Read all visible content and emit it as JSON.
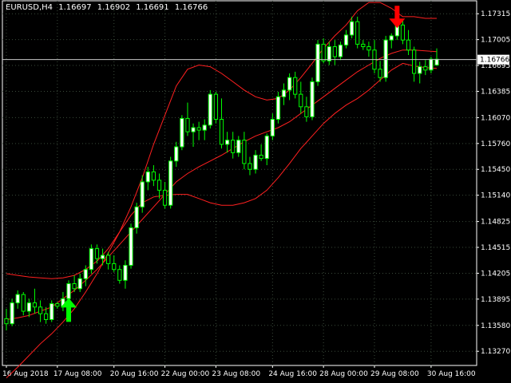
{
  "header": {
    "symbol": "EURUSD,H4",
    "open": "1.16697",
    "high": "1.16902",
    "low": "1.16691",
    "close": "1.16766"
  },
  "colors": {
    "background": "#000000",
    "grid": "#3a4a3a",
    "bull_candle": "#ffffff",
    "bear_candle": "#000000",
    "candle_outline": "#00ff00",
    "bands": "#ff2020",
    "buy_arrow": "#00ff00",
    "sell_arrow": "#ff0000",
    "price_line": "#c8c8c8"
  },
  "chart_data": {
    "type": "candlestick",
    "symbol": "EURUSD",
    "timeframe": "H4",
    "ylim": [
      1.131,
      1.1747
    ],
    "y_ticks": [
      "1.17315",
      "1.17005",
      "1.16695",
      "1.16385",
      "1.16070",
      "1.15760",
      "1.15450",
      "1.15140",
      "1.14825",
      "1.14515",
      "1.14205",
      "1.13895",
      "1.13580",
      "1.13270"
    ],
    "x_ticks": [
      "16 Aug 2018",
      "17 Aug 08:00",
      "20 Aug 16:00",
      "22 Aug 00:00",
      "23 Aug 08:00",
      "24 Aug 16:00",
      "28 Aug 00:00",
      "29 Aug 08:00",
      "30 Aug 16:00"
    ],
    "current_price": 1.16766,
    "current_price_label": "1.16766",
    "candles": [
      [
        1.1366,
        1.1378,
        1.1352,
        1.136
      ],
      [
        1.136,
        1.139,
        1.1357,
        1.1385
      ],
      [
        1.1385,
        1.14,
        1.1378,
        1.1395
      ],
      [
        1.1395,
        1.1398,
        1.137,
        1.1375
      ],
      [
        1.1375,
        1.139,
        1.1368,
        1.1385
      ],
      [
        1.1385,
        1.1402,
        1.1372,
        1.138
      ],
      [
        1.138,
        1.1388,
        1.1362,
        1.1372
      ],
      [
        1.1372,
        1.138,
        1.136,
        1.1365
      ],
      [
        1.1365,
        1.1388,
        1.1362,
        1.1384
      ],
      [
        1.1384,
        1.1386,
        1.1378,
        1.1381
      ],
      [
        1.1381,
        1.1398,
        1.1375,
        1.139
      ],
      [
        1.139,
        1.1412,
        1.1386,
        1.1408
      ],
      [
        1.1408,
        1.1418,
        1.1398,
        1.1402
      ],
      [
        1.1402,
        1.142,
        1.1398,
        1.1414
      ],
      [
        1.1414,
        1.143,
        1.1405,
        1.1425
      ],
      [
        1.1425,
        1.1455,
        1.142,
        1.145
      ],
      [
        1.145,
        1.1455,
        1.1432,
        1.1438
      ],
      [
        1.1438,
        1.145,
        1.143,
        1.1442
      ],
      [
        1.1442,
        1.1446,
        1.1425,
        1.1432
      ],
      [
        1.1432,
        1.1442,
        1.1422,
        1.1425
      ],
      [
        1.1425,
        1.143,
        1.1408,
        1.1412
      ],
      [
        1.1412,
        1.1436,
        1.1402,
        1.143
      ],
      [
        1.143,
        1.148,
        1.1426,
        1.1475
      ],
      [
        1.1475,
        1.1505,
        1.1468,
        1.15
      ],
      [
        1.15,
        1.1538,
        1.1493,
        1.153
      ],
      [
        1.153,
        1.1548,
        1.152,
        1.1542
      ],
      [
        1.1542,
        1.155,
        1.1525,
        1.1532
      ],
      [
        1.1532,
        1.154,
        1.151,
        1.152
      ],
      [
        1.152,
        1.153,
        1.1498,
        1.1502
      ],
      [
        1.1502,
        1.156,
        1.1498,
        1.1555
      ],
      [
        1.1555,
        1.1578,
        1.1548,
        1.1572
      ],
      [
        1.1572,
        1.161,
        1.1568,
        1.1606
      ],
      [
        1.1606,
        1.1625,
        1.1585,
        1.159
      ],
      [
        1.159,
        1.16,
        1.1572,
        1.1595
      ],
      [
        1.1595,
        1.1602,
        1.158,
        1.1592
      ],
      [
        1.1592,
        1.1605,
        1.158,
        1.1598
      ],
      [
        1.1598,
        1.164,
        1.1594,
        1.1635
      ],
      [
        1.1635,
        1.1638,
        1.16,
        1.1605
      ],
      [
        1.1605,
        1.163,
        1.157,
        1.1575
      ],
      [
        1.1575,
        1.159,
        1.1565,
        1.158
      ],
      [
        1.158,
        1.159,
        1.1558,
        1.1565
      ],
      [
        1.1565,
        1.1585,
        1.156,
        1.158
      ],
      [
        1.158,
        1.159,
        1.1545,
        1.1552
      ],
      [
        1.1552,
        1.156,
        1.1538,
        1.1545
      ],
      [
        1.1545,
        1.1568,
        1.154,
        1.1562
      ],
      [
        1.1562,
        1.1575,
        1.1555,
        1.1558
      ],
      [
        1.1558,
        1.1588,
        1.155,
        1.1585
      ],
      [
        1.1585,
        1.1612,
        1.158,
        1.1605
      ],
      [
        1.1605,
        1.1638,
        1.16,
        1.1632
      ],
      [
        1.1632,
        1.1648,
        1.1622,
        1.164
      ],
      [
        1.164,
        1.166,
        1.1628,
        1.1655
      ],
      [
        1.1655,
        1.1662,
        1.163,
        1.1635
      ],
      [
        1.1635,
        1.165,
        1.1612,
        1.162
      ],
      [
        1.162,
        1.1632,
        1.1602,
        1.1608
      ],
      [
        1.1608,
        1.1655,
        1.1604,
        1.165
      ],
      [
        1.165,
        1.17,
        1.1645,
        1.1695
      ],
      [
        1.1695,
        1.1702,
        1.1672,
        1.1675
      ],
      [
        1.1675,
        1.1698,
        1.167,
        1.1692
      ],
      [
        1.1692,
        1.17,
        1.167,
        1.168
      ],
      [
        1.168,
        1.1698,
        1.1676,
        1.1694
      ],
      [
        1.1694,
        1.1712,
        1.169,
        1.1706
      ],
      [
        1.1706,
        1.1728,
        1.1702,
        1.1722
      ],
      [
        1.1722,
        1.1728,
        1.169,
        1.1695
      ],
      [
        1.1695,
        1.17,
        1.1688,
        1.1692
      ],
      [
        1.1692,
        1.1698,
        1.168,
        1.1688
      ],
      [
        1.1688,
        1.17,
        1.166,
        1.1665
      ],
      [
        1.1665,
        1.1675,
        1.165,
        1.1655
      ],
      [
        1.1655,
        1.1705,
        1.165,
        1.17
      ],
      [
        1.17,
        1.1708,
        1.169,
        1.1705
      ],
      [
        1.1705,
        1.1722,
        1.17,
        1.1718
      ],
      [
        1.1718,
        1.1725,
        1.1695,
        1.17
      ],
      [
        1.17,
        1.1712,
        1.1682,
        1.1688
      ],
      [
        1.1688,
        1.1692,
        1.165,
        1.166
      ],
      [
        1.166,
        1.1674,
        1.1648,
        1.1668
      ],
      [
        1.1668,
        1.1676,
        1.1658,
        1.1664
      ],
      [
        1.1664,
        1.168,
        1.166,
        1.1677
      ],
      [
        1.167,
        1.169,
        1.1669,
        1.1677
      ]
    ],
    "band_upper": [
      1.142,
      1.1418,
      1.1416,
      1.1415,
      1.1414,
      1.1415,
      1.1418,
      1.1425,
      1.1435,
      1.145,
      1.147,
      1.15,
      1.1535,
      1.1575,
      1.161,
      1.1645,
      1.1665,
      1.167,
      1.1668,
      1.166,
      1.165,
      1.164,
      1.1632,
      1.1628,
      1.163,
      1.164,
      1.1655,
      1.1672,
      1.169,
      1.1705,
      1.1718,
      1.1735,
      1.1745,
      1.1745,
      1.1738,
      1.1728,
      1.1728,
      1.1726,
      1.1726
    ],
    "band_middle": [
      1.1365,
      1.1367,
      1.137,
      1.1375,
      1.138,
      1.139,
      1.14,
      1.1412,
      1.1425,
      1.144,
      1.1455,
      1.147,
      1.1485,
      1.15,
      1.1515,
      1.153,
      1.154,
      1.1548,
      1.1555,
      1.1562,
      1.157,
      1.1578,
      1.1585,
      1.159,
      1.1595,
      1.1602,
      1.1612,
      1.1622,
      1.1632,
      1.1642,
      1.1652,
      1.1662,
      1.167,
      1.1678,
      1.1684,
      1.1688,
      1.1688,
      1.1687,
      1.1686
    ],
    "band_lower": [
      1.1295,
      1.1308,
      1.1322,
      1.1336,
      1.1348,
      1.1362,
      1.1378,
      1.1398,
      1.142,
      1.1445,
      1.147,
      1.149,
      1.1505,
      1.1512,
      1.1514,
      1.1515,
      1.1515,
      1.151,
      1.1505,
      1.1502,
      1.1502,
      1.1505,
      1.151,
      1.152,
      1.1535,
      1.1552,
      1.157,
      1.1585,
      1.16,
      1.1612,
      1.1622,
      1.163,
      1.164,
      1.1652,
      1.1664,
      1.1672,
      1.1669,
      1.1667,
      1.1666
    ],
    "signals": [
      {
        "type": "buy",
        "candle_index": 11,
        "price": 1.1368
      },
      {
        "type": "sell",
        "candle_index": 69,
        "price": 1.172
      }
    ]
  }
}
